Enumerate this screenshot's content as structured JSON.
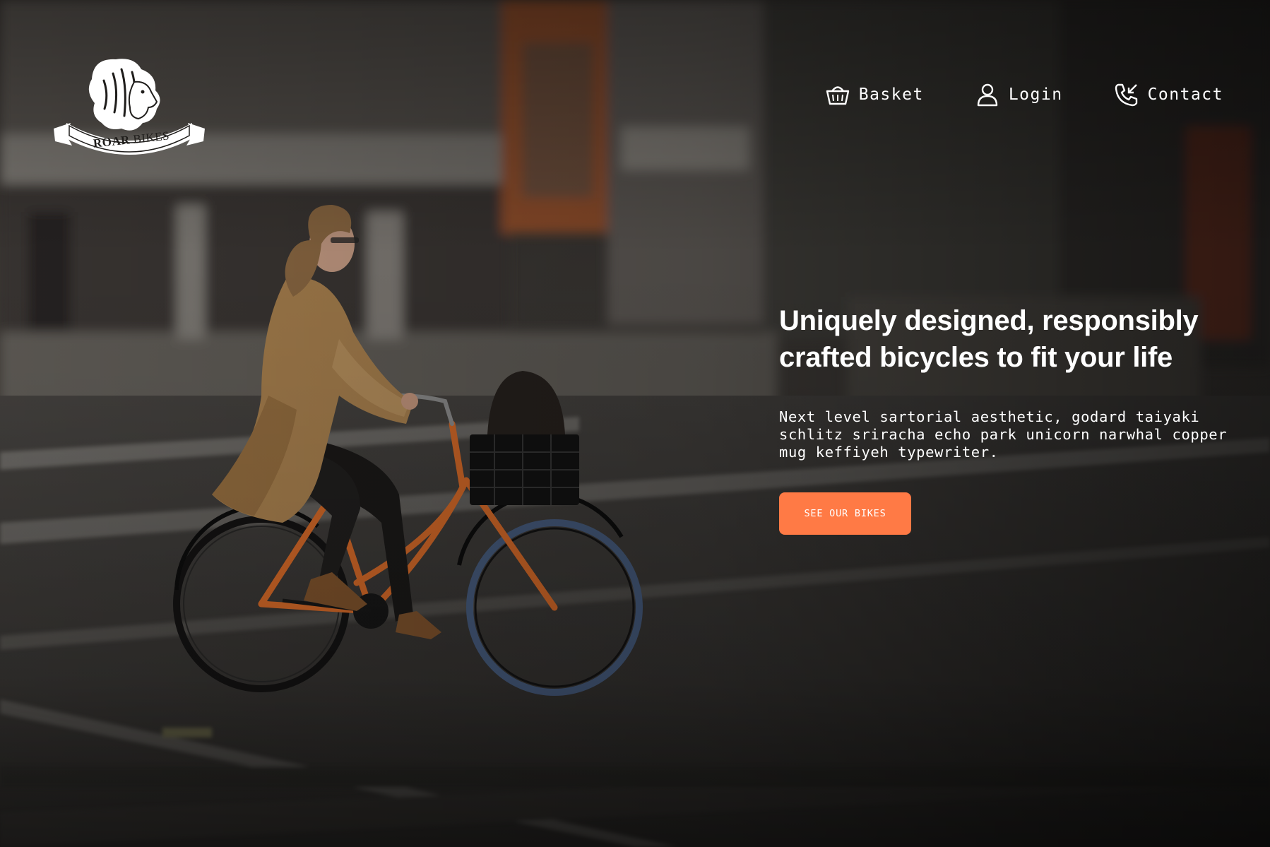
{
  "brand": {
    "logo_text_1": "ROAR",
    "logo_text_2": "BIKES",
    "logo_icon": "lion-head-icon"
  },
  "nav": {
    "items": [
      {
        "label": "Basket",
        "icon": "basket-icon"
      },
      {
        "label": "Login",
        "icon": "user-icon"
      },
      {
        "label": "Contact",
        "icon": "phone-icon"
      }
    ]
  },
  "hero": {
    "title": "Uniquely designed, responsibly crafted bicycles to fit your life",
    "description": "Next level sartorial aesthetic, godard taiyaki schlitz sriracha echo park unicorn narwhal copper mug keffiyeh typewriter.",
    "cta_label": "SEE OUR BIKES",
    "image_subject": "woman-riding-orange-bicycle-photo"
  },
  "colors": {
    "accent": "#ff7a45",
    "text": "#ffffff",
    "bike_frame": "#e8732c",
    "coat": "#c89a5e"
  }
}
